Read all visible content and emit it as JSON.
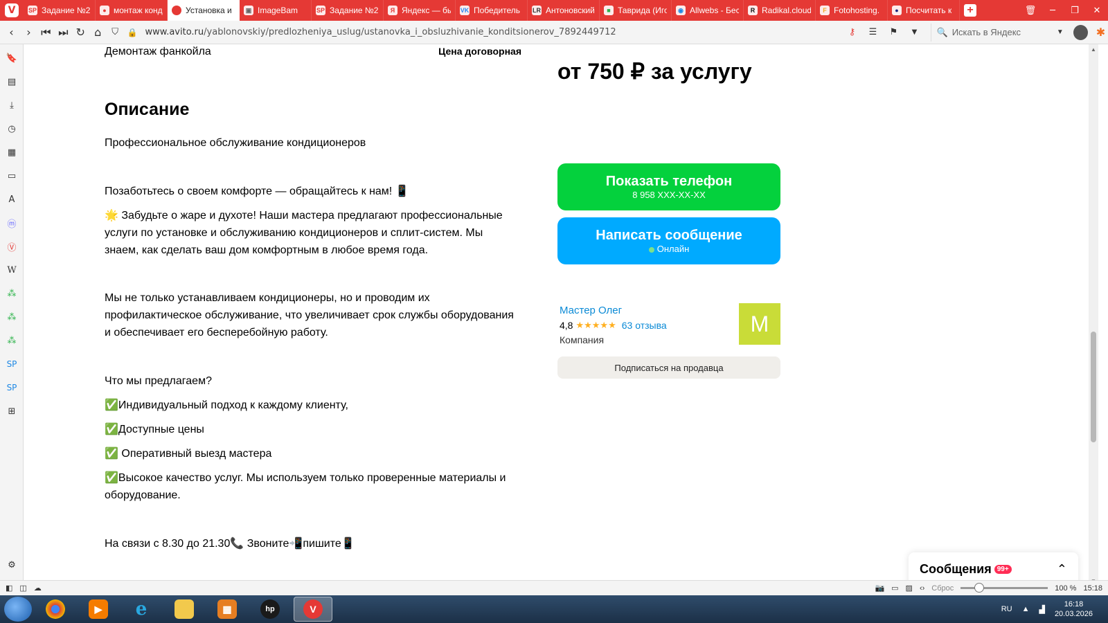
{
  "browser": {
    "tabs": [
      {
        "label": "Задание №2",
        "icon": "SP",
        "color": "#e53935"
      },
      {
        "label": "монтаж конд",
        "icon": "●",
        "color": "#e53935"
      },
      {
        "label": "Установка и",
        "icon": "●",
        "color": "#ffffff",
        "active": true
      },
      {
        "label": "ImageBam",
        "icon": "▣",
        "color": "#666666"
      },
      {
        "label": "Задание №2",
        "icon": "SP",
        "color": "#e53935"
      },
      {
        "label": "Яндекс — бы",
        "icon": "Я",
        "color": "#e53935"
      },
      {
        "label": "Победитель",
        "icon": "VK",
        "color": "#2787f5"
      },
      {
        "label": "Антоновский",
        "icon": "LR",
        "color": "#333333"
      },
      {
        "label": "Таврида (Иго",
        "icon": "■",
        "color": "#2db34a"
      },
      {
        "label": "Allwebs - Бес",
        "icon": "◉",
        "color": "#1e88e5"
      },
      {
        "label": "Radikal.cloud",
        "icon": "R",
        "color": "#111111"
      },
      {
        "label": "Fotohosting.",
        "icon": "F",
        "color": "#f5a623"
      },
      {
        "label": "Посчитать к",
        "icon": "●",
        "color": "#1a237e"
      }
    ],
    "url_host": "www.avito.ru",
    "url_path": "/yablonovskiy/predlozheniya_uslug/ustanovka_i_obsluzhivanie_konditsionerov_7892449712",
    "search_placeholder": "Искать в Яндекс"
  },
  "listing": {
    "prev_row_label": "Демонтаж фанкойла",
    "prev_row_price": "Цена договорная",
    "price": "от 750 ₽ за услугу",
    "description_title": "Описание",
    "paragraphs": [
      "Профессиональное обслуживание кондиционеров",
      "Позаботьтесь о своем комфорте — обращайтесь к нам! 📱",
      "🌟 Забудьте о жаре и духоте! Наши мастера предлагают профессиональные услуги по установке и обслуживанию кондиционеров и сплит-систем. Мы знаем, как сделать ваш дом комфортным в любое время года.",
      "Мы не только устанавливаем кондиционеры, но и проводим их профилактическое обслуживание, что увеличивает срок службы оборудования и обеспечивает его бесперебойную работу.",
      "Что мы предлагаем?",
      "✅Индивидуальный подход к каждому клиенту,",
      "✅Доступные цены",
      "✅ Оперативный выезд мастера",
      "✅Высокое качество услуг. Мы используем только проверенные материалы и оборудование.",
      "На связи с 8.30 до 21.30📞 Звоните📲пишите📱"
    ]
  },
  "contact": {
    "phone_button": "Показать телефон",
    "phone_masked": "8 958 XXX-XX-XX",
    "message_button": "Написать сообщение",
    "online_status": "Онлайн",
    "colors": {
      "phone": "#04d13d",
      "message": "#00aaff"
    }
  },
  "seller": {
    "name": "Мастер Олег",
    "rating": "4,8",
    "stars": "★★★★★",
    "reviews": "63 отзыва",
    "type": "Компания",
    "avatar_letter": "M",
    "subscribe": "Подписаться на продавца"
  },
  "messages_panel": {
    "title": "Сообщения",
    "badge": "99+"
  },
  "statusbar": {
    "reset": "Сброс",
    "zoom": "100 %",
    "time": "15:18"
  },
  "taskbar": {
    "lang": "RU",
    "time": "16:18",
    "date": "20.03.2026"
  }
}
